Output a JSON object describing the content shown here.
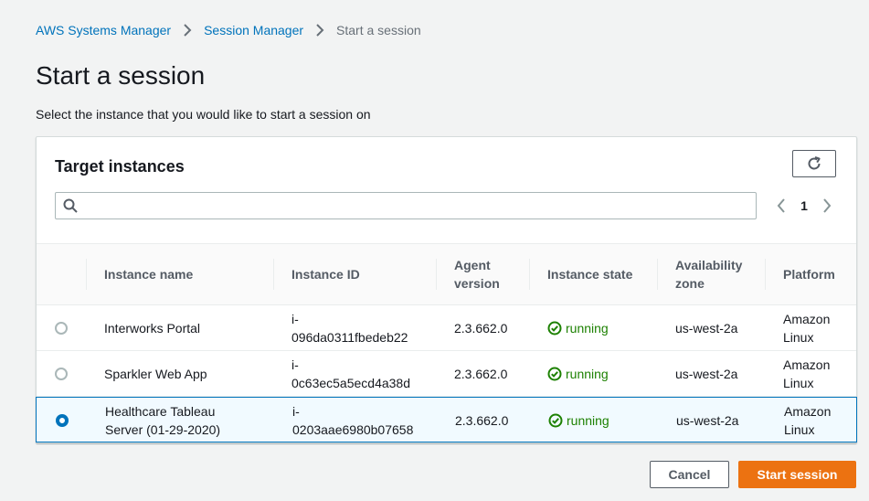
{
  "breadcrumb": {
    "items": [
      "AWS Systems Manager",
      "Session Manager"
    ],
    "current": "Start a session"
  },
  "page": {
    "title": "Start a session",
    "description": "Select the instance that you would like to start a session on"
  },
  "panel": {
    "title": "Target instances",
    "search_placeholder": "",
    "search_value": "",
    "page_number": "1",
    "icons": {
      "refresh": "refresh-icon",
      "search": "search-icon",
      "prev": "chevron-left-icon",
      "next": "chevron-right-icon"
    }
  },
  "table": {
    "columns": {
      "name": "Instance name",
      "id": "Instance ID",
      "agent_line1": "Agent",
      "agent_line2": "version",
      "state": "Instance state",
      "az_line1": "Availability",
      "az_line2": "zone",
      "platform": "Platform"
    },
    "rows": [
      {
        "selected": false,
        "name_line1": "Interworks Portal",
        "name_line2": "",
        "id_line1": "i-",
        "id_line2": "096da0311fbedeb22",
        "agent": "2.3.662.0",
        "state": "running",
        "az": "us-west-2a",
        "platform_line1": "Amazon",
        "platform_line2": "Linux"
      },
      {
        "selected": false,
        "name_line1": "Sparkler Web App",
        "name_line2": "",
        "id_line1": "i-",
        "id_line2": "0c63ec5a5ecd4a38d",
        "agent": "2.3.662.0",
        "state": "running",
        "az": "us-west-2a",
        "platform_line1": "Amazon",
        "platform_line2": "Linux"
      },
      {
        "selected": true,
        "name_line1": "Healthcare Tableau",
        "name_line2": "Server (01-29-2020)",
        "id_line1": "i-",
        "id_line2": "0203aae6980b07658",
        "agent": "2.3.662.0",
        "state": "running",
        "az": "us-west-2a",
        "platform_line1": "Amazon",
        "platform_line2": "Linux"
      }
    ]
  },
  "actions": {
    "cancel": "Cancel",
    "start": "Start session"
  },
  "colors": {
    "link": "#0073bb",
    "accent": "#ec7211",
    "running": "#1d8102",
    "selected_bg": "#f1faff"
  }
}
